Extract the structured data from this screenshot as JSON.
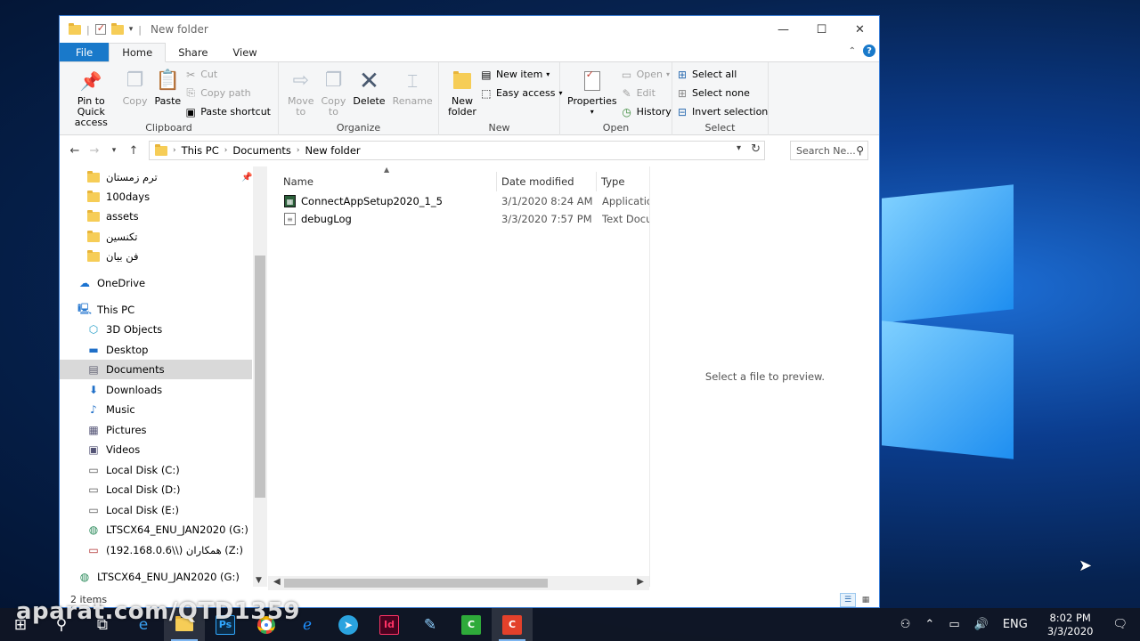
{
  "window": {
    "title": "New folder",
    "controls": {
      "minimize": "—",
      "maximize": "☐",
      "close": "✕"
    }
  },
  "ribbon_tabs": [
    "File",
    "Home",
    "Share",
    "View"
  ],
  "ribbon": {
    "clipboard": {
      "label": "Clipboard",
      "pin": "Pin to Quick access",
      "pin_l1": "Pin to Quick",
      "pin_l2": "access",
      "copy": "Copy",
      "paste": "Paste",
      "cut": "Cut",
      "copy_path": "Copy path",
      "paste_shortcut": "Paste shortcut"
    },
    "organize": {
      "label": "Organize",
      "move_l1": "Move",
      "move_l2": "to",
      "copy_l1": "Copy",
      "copy_l2": "to",
      "delete": "Delete",
      "rename": "Rename"
    },
    "new": {
      "label": "New",
      "new_folder_l1": "New",
      "new_folder_l2": "folder",
      "new_item": "New item",
      "easy_access": "Easy access"
    },
    "open": {
      "label": "Open",
      "properties": "Properties",
      "open": "Open",
      "edit": "Edit",
      "history": "History"
    },
    "select": {
      "label": "Select",
      "select_all": "Select all",
      "select_none": "Select none",
      "invert": "Invert selection"
    }
  },
  "address": {
    "crumbs": [
      "This PC",
      "Documents",
      "New folder"
    ],
    "search_placeholder": "Search Ne..."
  },
  "nav_items": [
    {
      "label": "ترم زمستان",
      "icon": "folder-icon",
      "pinned": true
    },
    {
      "label": "100days",
      "icon": "folder-icon"
    },
    {
      "label": "assets",
      "icon": "folder-icon"
    },
    {
      "label": "تکنسین",
      "icon": "folder-icon"
    },
    {
      "label": "فن بیان",
      "icon": "folder-icon"
    },
    {
      "label": "OneDrive",
      "icon": "cloud-icon"
    },
    {
      "label": "This PC",
      "icon": "computer-icon"
    },
    {
      "label": "3D Objects",
      "icon": "cube-icon"
    },
    {
      "label": "Desktop",
      "icon": "desktop-icon"
    },
    {
      "label": "Documents",
      "icon": "documents-icon",
      "selected": true
    },
    {
      "label": "Downloads",
      "icon": "download-icon"
    },
    {
      "label": "Music",
      "icon": "music-icon"
    },
    {
      "label": "Pictures",
      "icon": "pictures-icon"
    },
    {
      "label": "Videos",
      "icon": "videos-icon"
    },
    {
      "label": "Local Disk (C:)",
      "icon": "disk-icon"
    },
    {
      "label": "Local Disk (D:)",
      "icon": "disk-icon"
    },
    {
      "label": "Local Disk (E:)",
      "icon": "disk-icon"
    },
    {
      "label": "LTSCX64_ENU_JAN2020 (G:)",
      "icon": "dvd-icon"
    },
    {
      "label": "همکاران (\\\\192.168.0.6) (Z:)",
      "icon": "network-drive-icon"
    },
    {
      "label": "LTSCX64_ENU_JAN2020 (G:)",
      "icon": "dvd-icon"
    }
  ],
  "columns": {
    "name": "Name",
    "date": "Date modified",
    "type": "Type"
  },
  "files": [
    {
      "name": "ConnectAppSetup2020_1_5",
      "date": "3/1/2020 8:24 AM",
      "type": "Application",
      "icon": "app-icon"
    },
    {
      "name": "debugLog",
      "date": "3/3/2020 7:57 PM",
      "type": "Text Document",
      "icon": "text-file-icon"
    }
  ],
  "preview_text": "Select a file to preview.",
  "status": "2 items",
  "taskbar": {
    "time": "8:02 PM",
    "date": "3/3/2020",
    "lang": "ENG"
  },
  "watermark": "aparat.com/QTD1359"
}
